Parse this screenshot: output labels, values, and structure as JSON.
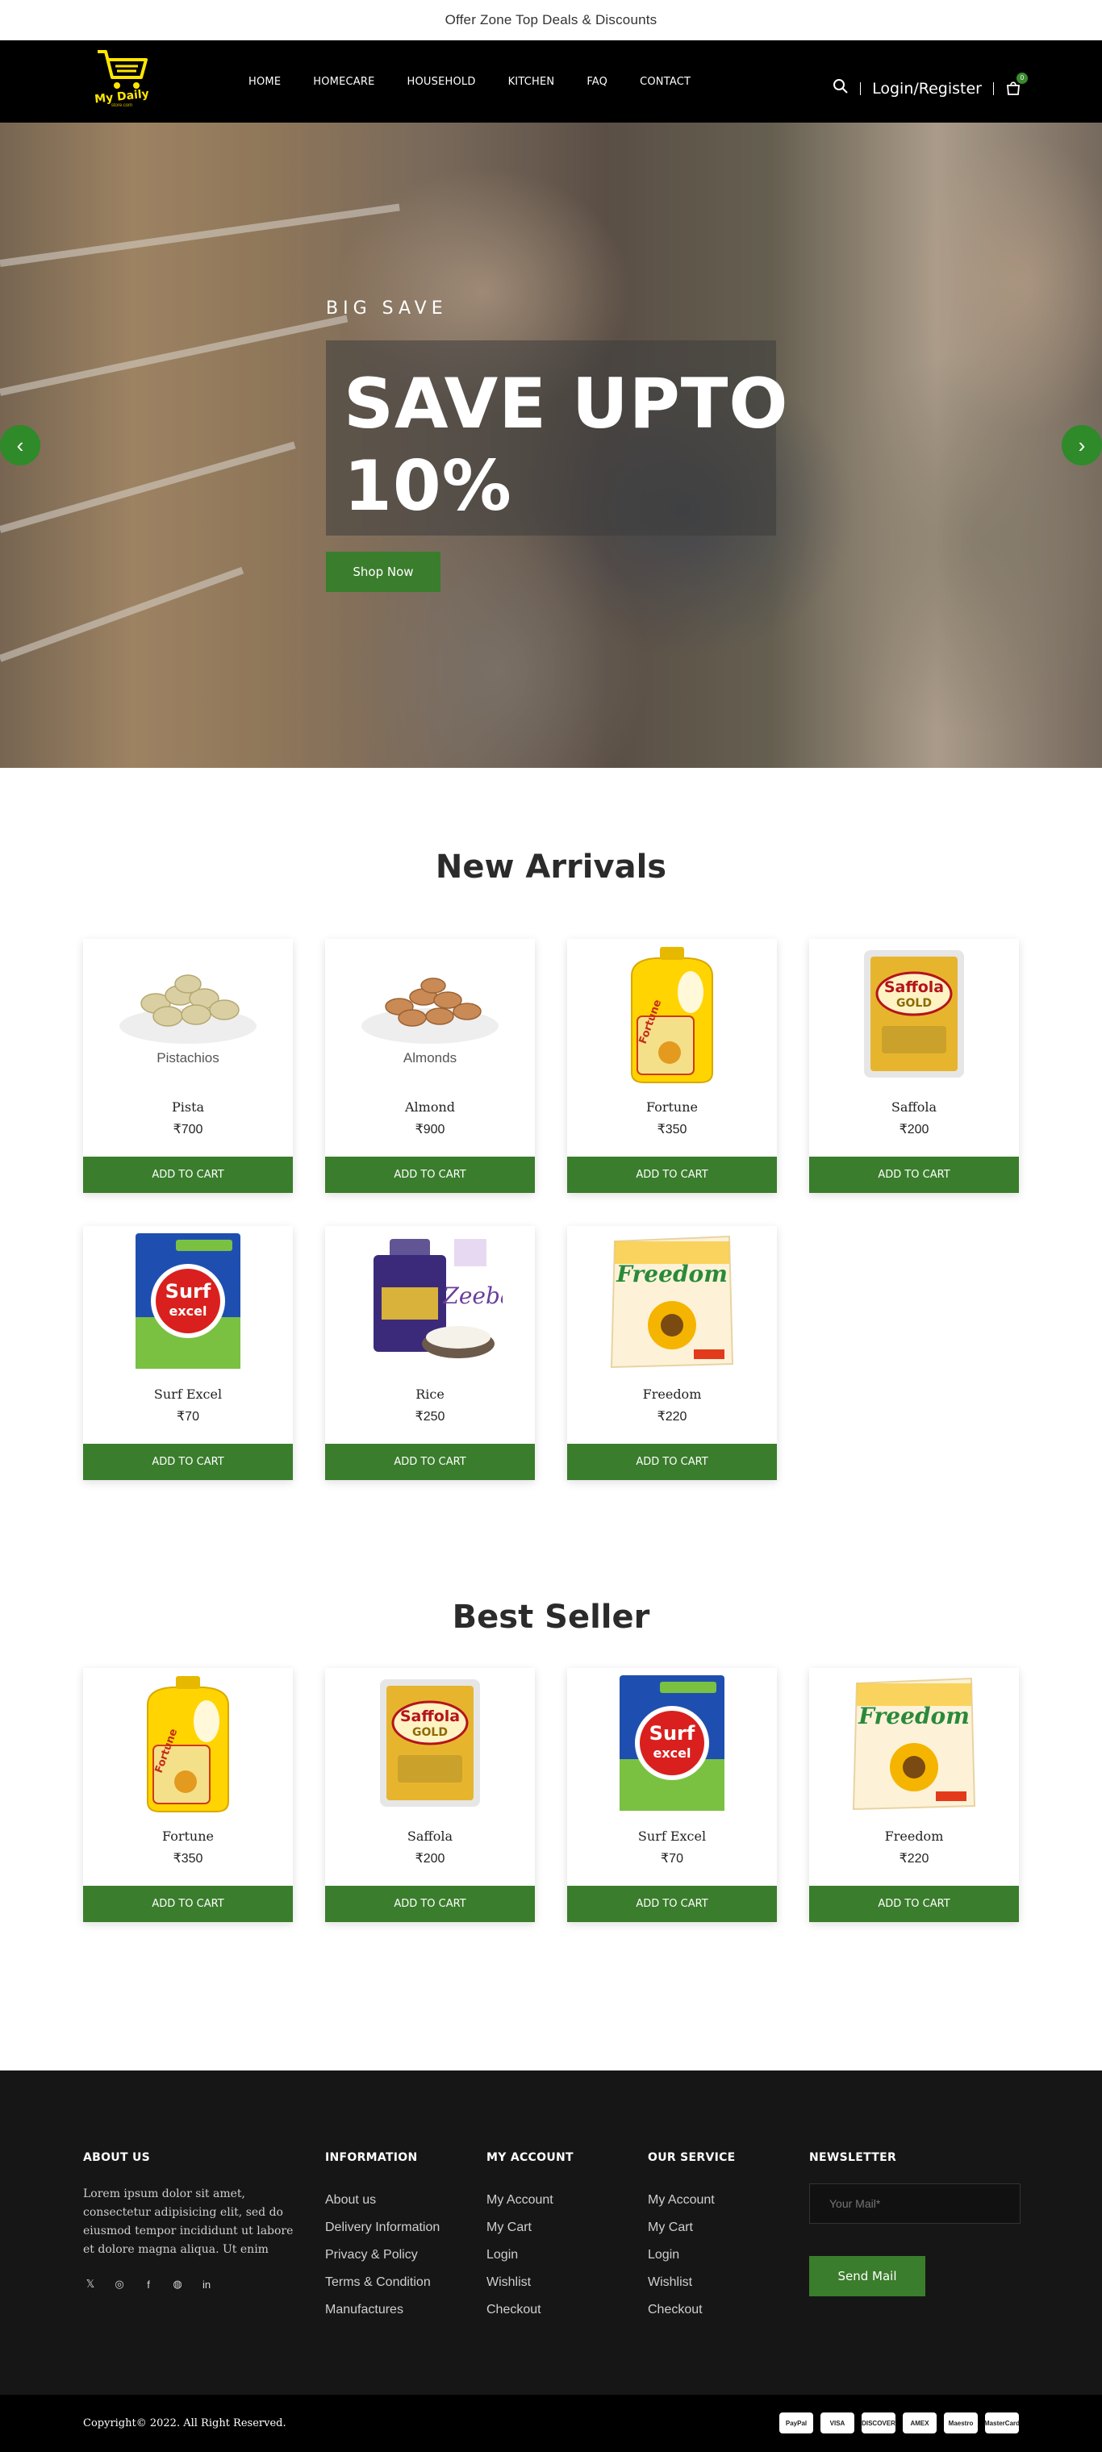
{
  "offer_bar": {
    "text": "Offer Zone Top Deals & Discounts"
  },
  "header": {
    "logo_text": "My Daily",
    "logo_sub": "store.com",
    "nav": [
      "HOME",
      "HOMECARE",
      "HOUSEHOLD",
      "KITCHEN",
      "FAQ",
      "CONTACT"
    ],
    "login_label": "Login/Register",
    "cart_count": "0",
    "icons": {
      "search": "search-icon",
      "cart": "shopping-bag-icon"
    }
  },
  "hero": {
    "tag": "BIG SAVE",
    "title": "SAVE UPTO 10%",
    "button": "Shop Now",
    "prev_arrow": "‹",
    "next_arrow": "›"
  },
  "new_arrivals": {
    "title": "New Arrivals",
    "products": [
      {
        "name": "Pista",
        "price": "₹700",
        "image": "pistachios",
        "image_caption": "Pistachios",
        "button": "ADD TO CART"
      },
      {
        "name": "Almond",
        "price": "₹900",
        "image": "almonds",
        "image_caption": "Almonds",
        "button": "ADD TO CART"
      },
      {
        "name": "Fortune",
        "price": "₹350",
        "image": "fortune-oil",
        "button": "ADD TO CART"
      },
      {
        "name": "Saffola",
        "price": "₹200",
        "image": "saffola-gold",
        "button": "ADD TO CART"
      },
      {
        "name": "Surf Excel",
        "price": "₹70",
        "image": "surf-excel",
        "button": "ADD TO CART"
      },
      {
        "name": "Rice",
        "price": "₹250",
        "image": "zeeba-rice",
        "button": "ADD TO CART"
      },
      {
        "name": "Freedom",
        "price": "₹220",
        "image": "freedom-oil",
        "button": "ADD TO CART"
      }
    ]
  },
  "best_seller": {
    "title": "Best Seller",
    "products": [
      {
        "name": "Fortune",
        "price": "₹350",
        "image": "fortune-oil",
        "button": "ADD TO CART"
      },
      {
        "name": "Saffola",
        "price": "₹200",
        "image": "saffola-gold",
        "button": "ADD TO CART"
      },
      {
        "name": "Surf Excel",
        "price": "₹70",
        "image": "surf-excel",
        "button": "ADD TO CART"
      },
      {
        "name": "Freedom",
        "price": "₹220",
        "image": "freedom-oil",
        "button": "ADD TO CART"
      }
    ]
  },
  "footer": {
    "about": {
      "title": "ABOUT US",
      "text": "Lorem ipsum dolor sit amet, consectetur adipisicing elit, sed do eiusmod tempor incididunt ut labore et dolore magna aliqua. Ut enim",
      "socials": [
        "twitter-icon",
        "instagram-icon",
        "facebook-icon",
        "dribbble-icon",
        "linkedin-icon"
      ]
    },
    "information": {
      "title": "INFORMATION",
      "links": [
        "About us",
        "Delivery Information",
        "Privacy & Policy",
        "Terms & Condition",
        "Manufactures"
      ]
    },
    "my_account": {
      "title": "MY ACCOUNT",
      "links": [
        "My Account",
        "My Cart",
        "Login",
        "Wishlist",
        "Checkout"
      ]
    },
    "our_service": {
      "title": "OUR SERVICE",
      "links": [
        "My Account",
        "My Cart",
        "Login",
        "Wishlist",
        "Checkout"
      ]
    },
    "newsletter": {
      "title": "NEWSLETTER",
      "placeholder": "Your Mail*",
      "button": "Send Mail"
    }
  },
  "bottom_bar": {
    "copyright": "Copyright© 2022. All Right Reserved.",
    "payments": [
      "PayPal",
      "VISA",
      "DISCOVER",
      "AMEX",
      "Maestro",
      "MasterCard"
    ]
  },
  "colors": {
    "accent": "#3a7d2c",
    "header_bg": "#000000",
    "footer_bg": "#161616",
    "logo_yellow": "#ffe600"
  }
}
